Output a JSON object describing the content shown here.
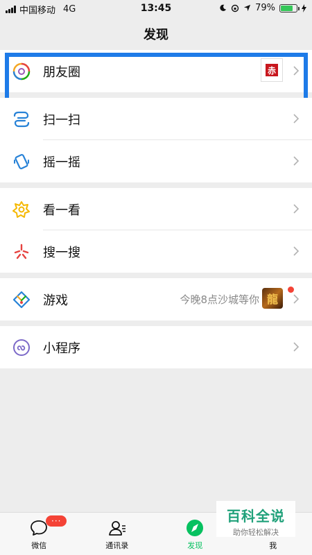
{
  "status_bar": {
    "carrier": "中国移动",
    "network": "4G",
    "time": "13:45",
    "battery_percent": "79%",
    "battery_level": 0.79
  },
  "nav": {
    "title": "发现"
  },
  "groups": {
    "moments": {
      "label": "朋友圈",
      "thumb_text": "赤"
    },
    "scan": {
      "label": "扫一扫"
    },
    "shake": {
      "label": "摇一摇"
    },
    "top_stories": {
      "label": "看一看"
    },
    "search": {
      "label": "搜一搜"
    },
    "games": {
      "label": "游戏",
      "note": "今晚8点沙城等你",
      "thumb_text": "龍"
    },
    "mini_programs": {
      "label": "小程序"
    }
  },
  "tabbar": {
    "chats": {
      "label": "微信",
      "badge": "···"
    },
    "contacts": {
      "label": "通讯录"
    },
    "discover": {
      "label": "发现"
    },
    "me": {
      "label": "我"
    }
  },
  "watermark": {
    "main": "百科全说",
    "sub": "助你轻松解决"
  },
  "colors": {
    "accent": "#07c160",
    "highlight": "#1e7be8",
    "badge": "#f44336"
  }
}
